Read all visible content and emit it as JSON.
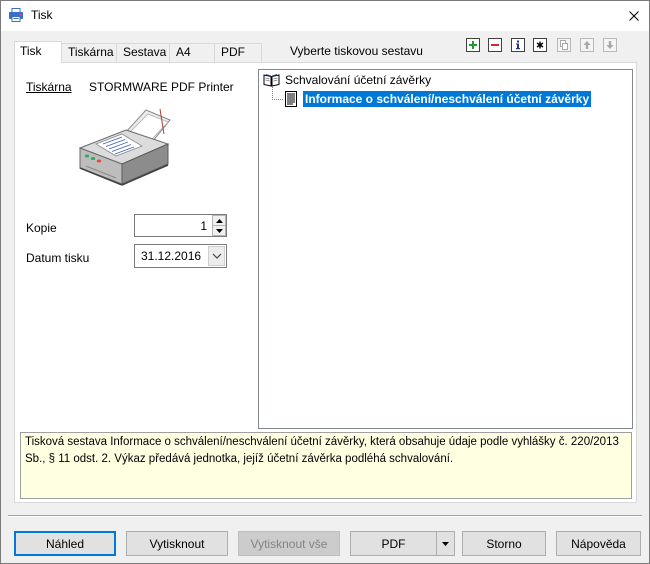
{
  "window": {
    "title": "Tisk",
    "app_icon": "print-app-icon",
    "close_icon": "close-icon"
  },
  "tabs": [
    {
      "label": "Tisk",
      "active": true
    },
    {
      "label": "Tiskárna",
      "active": false
    },
    {
      "label": "Sestava",
      "active": false
    },
    {
      "label": "A4",
      "active": false
    },
    {
      "label": "PDF",
      "active": false
    }
  ],
  "report_selector": {
    "label": "Vyberte tiskovou sestavu",
    "toolbar": [
      {
        "icon": "add-icon",
        "enabled": true
      },
      {
        "icon": "remove-icon",
        "enabled": true
      },
      {
        "icon": "info-icon",
        "enabled": true
      },
      {
        "icon": "asterisk-icon",
        "enabled": true
      },
      {
        "icon": "copy-icon",
        "enabled": false
      },
      {
        "icon": "move-up-icon",
        "enabled": false
      },
      {
        "icon": "move-down-icon",
        "enabled": false
      }
    ]
  },
  "print_settings": {
    "printer_label": "Tiskárna",
    "printer_name": "STORMWARE PDF Printer",
    "printer_icon": "printer-icon",
    "copies_label": "Kopie",
    "copies_value": "1",
    "print_date_label": "Datum tisku",
    "print_date_value": "31.12.2016"
  },
  "report_tree": {
    "root": {
      "label": "Schvalování účetní závěrky",
      "icon": "book-icon",
      "expanded": true
    },
    "children": [
      {
        "label": "Informace o schválení/neschválení účetní závěrky",
        "icon": "document-icon",
        "selected": true
      }
    ]
  },
  "description": {
    "text": "Tisková sestava Informace o schválení/neschválení účetní závěrky, která obsahuje údaje podle vyhlášky č. 220/2013 Sb., § 11 odst. 2. Výkaz předává jednotka, jejíž účetní závěrka podléhá schvalování."
  },
  "buttons": {
    "preview": "Náhled",
    "print": "Vytisknout",
    "print_all": {
      "label": "Vytisknout vše",
      "enabled": false
    },
    "pdf": "PDF",
    "cancel": "Storno",
    "help": "Nápověda"
  },
  "colors": {
    "selection": "#0078d7",
    "selection_text": "#ffffff",
    "description_background": "#ffffe1",
    "default_button_border": "#0078d7",
    "disabled_text": "#838383"
  }
}
